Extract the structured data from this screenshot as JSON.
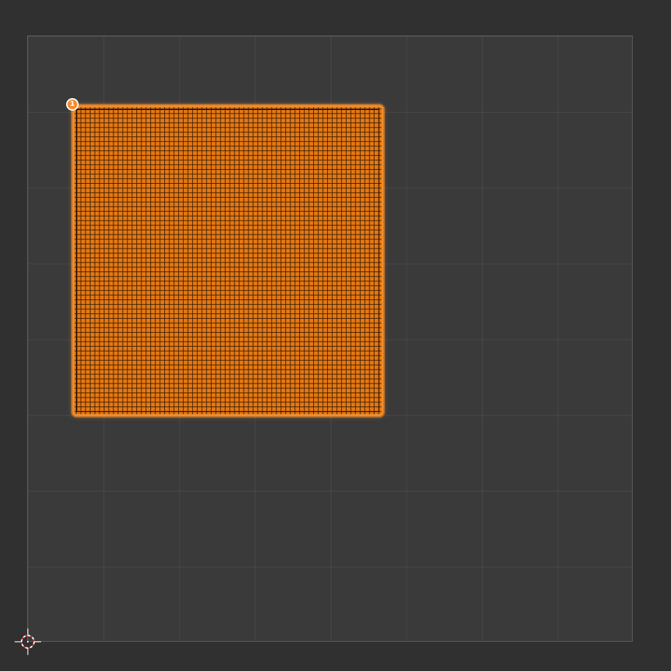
{
  "editor": {
    "type": "UV Editor"
  },
  "uv_island": {
    "vertex_marker_label": "1",
    "selection_color": "#f08c2a",
    "face_fill_color": "#e47812"
  },
  "colors": {
    "background": "#303030",
    "grid_background": "#3a3a3a",
    "grid_border": "#5e5e5e"
  },
  "icons": {
    "cursor": "3d-cursor-icon"
  }
}
